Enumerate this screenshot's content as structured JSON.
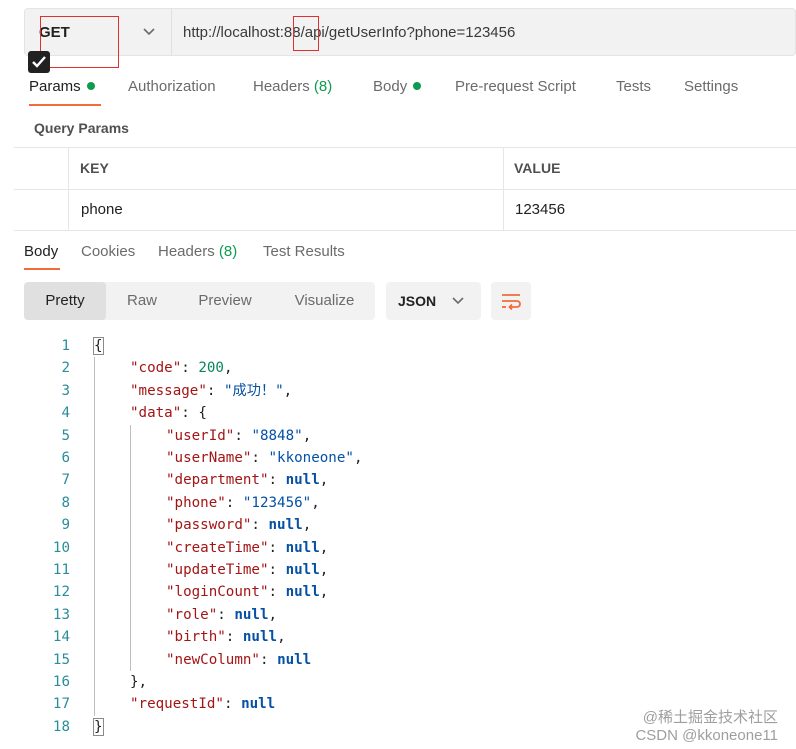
{
  "request": {
    "method": "GET",
    "url": "http://localhost:88/api/getUserInfo?phone=123456"
  },
  "request_tabs": [
    {
      "label": "Params",
      "indicator": "dot"
    },
    {
      "label": "Authorization"
    },
    {
      "label": "Headers",
      "count": "(8)"
    },
    {
      "label": "Body",
      "indicator": "dot"
    },
    {
      "label": "Pre-request Script"
    },
    {
      "label": "Tests"
    },
    {
      "label": "Settings"
    }
  ],
  "query_params": {
    "title": "Query Params",
    "headers": [
      "KEY",
      "VALUE"
    ],
    "rows": [
      {
        "checked": true,
        "key": "phone",
        "value": "123456"
      }
    ]
  },
  "response_tabs": [
    {
      "label": "Body"
    },
    {
      "label": "Cookies"
    },
    {
      "label": "Headers",
      "count": "(8)"
    },
    {
      "label": "Test Results"
    }
  ],
  "view_modes": [
    "Pretty",
    "Raw",
    "Preview",
    "Visualize"
  ],
  "format": "JSON",
  "code_lines": [
    {
      "n": "1",
      "parts": [
        [
          "p",
          "{"
        ]
      ]
    },
    {
      "n": "2",
      "parts": [
        [
          "k",
          "\"code\""
        ],
        [
          "p",
          ": "
        ],
        [
          "n",
          "200"
        ],
        [
          "p",
          ","
        ]
      ]
    },
    {
      "n": "3",
      "parts": [
        [
          "k",
          "\"message\""
        ],
        [
          "p",
          ": "
        ],
        [
          "s",
          "\"成功！\""
        ],
        [
          "p",
          ","
        ]
      ]
    },
    {
      "n": "4",
      "parts": [
        [
          "k",
          "\"data\""
        ],
        [
          "p",
          ": {"
        ]
      ]
    },
    {
      "n": "5",
      "parts": [
        [
          "k",
          "\"userId\""
        ],
        [
          "p",
          ": "
        ],
        [
          "s",
          "\"8848\""
        ],
        [
          "p",
          ","
        ]
      ]
    },
    {
      "n": "6",
      "parts": [
        [
          "k",
          "\"userName\""
        ],
        [
          "p",
          ": "
        ],
        [
          "s",
          "\"kkoneone\""
        ],
        [
          "p",
          ","
        ]
      ]
    },
    {
      "n": "7",
      "parts": [
        [
          "k",
          "\"department\""
        ],
        [
          "p",
          ": "
        ],
        [
          "nl",
          "null"
        ],
        [
          "p",
          ","
        ]
      ]
    },
    {
      "n": "8",
      "parts": [
        [
          "k",
          "\"phone\""
        ],
        [
          "p",
          ": "
        ],
        [
          "s",
          "\"123456\""
        ],
        [
          "p",
          ","
        ]
      ]
    },
    {
      "n": "9",
      "parts": [
        [
          "k",
          "\"password\""
        ],
        [
          "p",
          ": "
        ],
        [
          "nl",
          "null"
        ],
        [
          "p",
          ","
        ]
      ]
    },
    {
      "n": "10",
      "parts": [
        [
          "k",
          "\"createTime\""
        ],
        [
          "p",
          ": "
        ],
        [
          "nl",
          "null"
        ],
        [
          "p",
          ","
        ]
      ]
    },
    {
      "n": "11",
      "parts": [
        [
          "k",
          "\"updateTime\""
        ],
        [
          "p",
          ": "
        ],
        [
          "nl",
          "null"
        ],
        [
          "p",
          ","
        ]
      ]
    },
    {
      "n": "12",
      "parts": [
        [
          "k",
          "\"loginCount\""
        ],
        [
          "p",
          ": "
        ],
        [
          "nl",
          "null"
        ],
        [
          "p",
          ","
        ]
      ]
    },
    {
      "n": "13",
      "parts": [
        [
          "k",
          "\"role\""
        ],
        [
          "p",
          ": "
        ],
        [
          "nl",
          "null"
        ],
        [
          "p",
          ","
        ]
      ]
    },
    {
      "n": "14",
      "parts": [
        [
          "k",
          "\"birth\""
        ],
        [
          "p",
          ": "
        ],
        [
          "nl",
          "null"
        ],
        [
          "p",
          ","
        ]
      ]
    },
    {
      "n": "15",
      "parts": [
        [
          "k",
          "\"newColumn\""
        ],
        [
          "p",
          ": "
        ],
        [
          "nl",
          "null"
        ]
      ]
    },
    {
      "n": "16",
      "parts": [
        [
          "p",
          "},"
        ]
      ]
    },
    {
      "n": "17",
      "parts": [
        [
          "k",
          "\"requestId\""
        ],
        [
          "p",
          ": "
        ],
        [
          "nl",
          "null"
        ]
      ]
    },
    {
      "n": "18",
      "parts": [
        [
          "p",
          "}"
        ]
      ]
    }
  ],
  "watermark": {
    "line1": "@稀土掘金技术社区",
    "line2": "CSDN @kkoneone11"
  },
  "icons": {
    "method_dropdown": "chevron-down-icon",
    "format_dropdown": "chevron-down-icon",
    "wrap": "text-wrap-icon",
    "checkbox": "checkmark-icon"
  },
  "colors": {
    "accent": "#f26b3a",
    "indicator_green": "#0c9b4f",
    "json_key": "#a31515",
    "json_string": "#0451a5",
    "json_number": "#098658"
  }
}
